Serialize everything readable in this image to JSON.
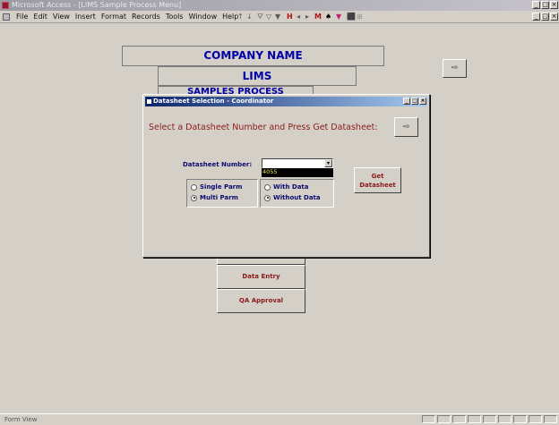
{
  "window": {
    "title": "Microsoft Access - [LIMS Sample Process Menu]",
    "min_glyph": "_",
    "max_glyph": "□",
    "close_glyph": "×"
  },
  "menu": {
    "items": [
      "File",
      "Edit",
      "View",
      "Insert",
      "Format",
      "Records",
      "Tools",
      "Window",
      "Help"
    ],
    "toolbar_glyphs": [
      "↑",
      "↓",
      "⛛",
      "▽",
      "▼",
      "H",
      "◂",
      "▸",
      "M",
      "♠",
      "▼",
      "⬛",
      "⊞"
    ]
  },
  "form": {
    "company_name": "COMPANY NAME",
    "lims": "LIMS",
    "samples_process": "SAMPLES PROCESS",
    "exit_glyph": "⇨",
    "buttons": {
      "data_entry": "Data Entry",
      "qa_approval": "QA Approval"
    }
  },
  "dialog": {
    "title": "Datasheet Selection - Coordinator",
    "prompt": "Select a Datasheet Number and Press Get Datasheet:",
    "exit_glyph": "⇨",
    "datasheet_label": "Datasheet Number:",
    "datasheet_value": "",
    "dropdown_options": [
      "4055"
    ],
    "parm_options": [
      "Single Parm",
      "Multi Parm"
    ],
    "parm_selected": "Multi Parm",
    "data_options": [
      "With Data",
      "Without Data"
    ],
    "data_selected": "Without Data",
    "get_datasheet": "Get\nDatasheet",
    "get_line1": "Get",
    "get_line2": "Datasheet"
  },
  "status": {
    "text": "Form View"
  }
}
